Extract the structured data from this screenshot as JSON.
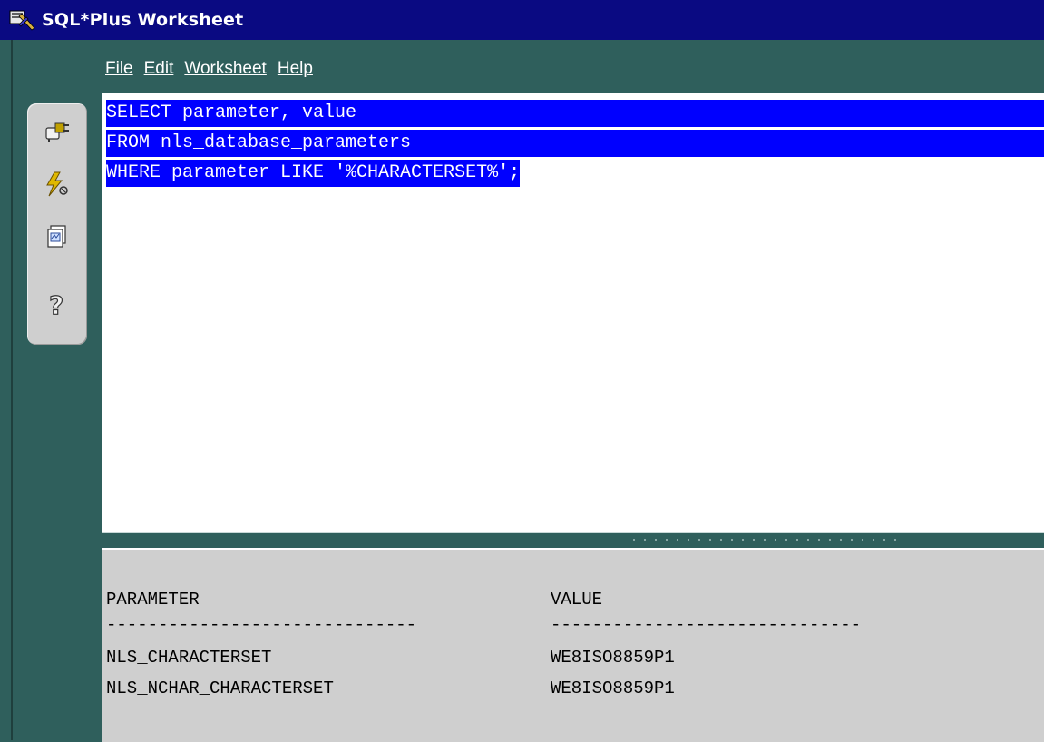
{
  "window": {
    "title": "SQL*Plus Worksheet"
  },
  "menu": [
    {
      "label": "File",
      "accel_index": 0
    },
    {
      "label": "Edit",
      "accel_index": 0
    },
    {
      "label": "Worksheet",
      "accel_index": 0
    },
    {
      "label": "Help",
      "accel_index": 0
    }
  ],
  "toolbar": {
    "connect_icon": "plug-connect-icon",
    "execute_icon": "lightning-execute-icon",
    "history_icon": "command-history-icon",
    "help_icon": "help-question-icon"
  },
  "editor": {
    "lines": [
      "SELECT parameter, value",
      "FROM nls_database_parameters",
      "WHERE parameter LIKE '%CHARACTERSET%';"
    ],
    "selection_color": "#0000ff"
  },
  "results": {
    "header": [
      "PARAMETER",
      "VALUE"
    ],
    "separator": [
      "------------------------------",
      "------------------------------"
    ],
    "rows": [
      [
        "NLS_CHARACTERSET",
        "WE8ISO8859P1"
      ],
      [
        "NLS_NCHAR_CHARACTERSET",
        "WE8ISO8859P1"
      ]
    ]
  },
  "colors": {
    "titlebar": "#0a0a82",
    "frame": "#2f5f5c",
    "panel": "#cfcfcf"
  }
}
